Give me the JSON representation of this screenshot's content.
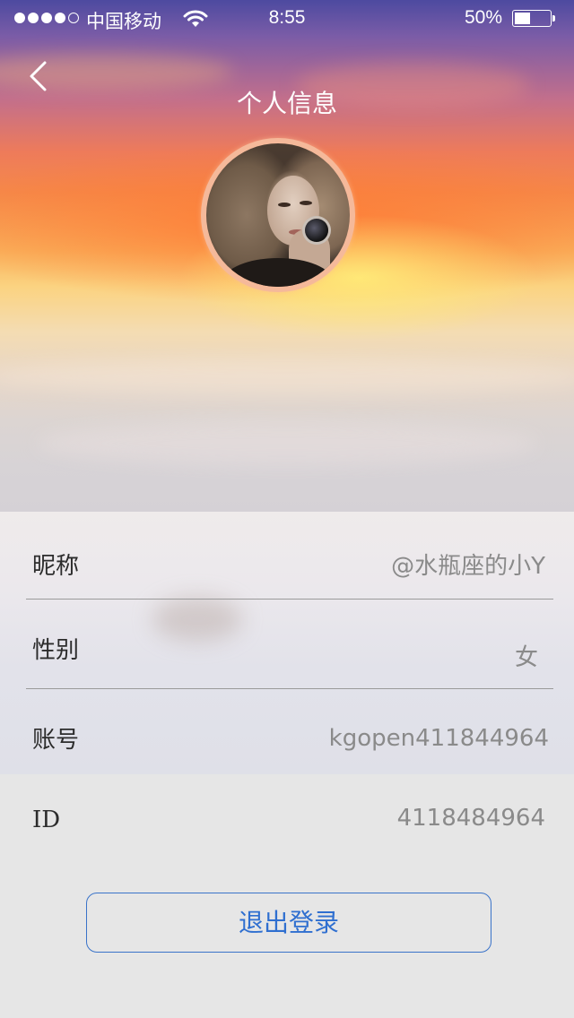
{
  "status_bar": {
    "carrier": "中国移动",
    "time": "8:55",
    "battery_percent": "50%",
    "battery_level": 0.5,
    "signal_bars_filled": 4,
    "signal_bars_total": 5
  },
  "nav": {
    "back_icon": "chevron-left-icon",
    "title": "个人信息"
  },
  "profile": {
    "rows": [
      {
        "label": "昵称",
        "value": "@水瓶座的小Y"
      },
      {
        "label": "性别",
        "value": "女"
      },
      {
        "label": "账号",
        "value": "kgopen411844964"
      },
      {
        "label": "ID",
        "value": "4118484964"
      }
    ]
  },
  "actions": {
    "logout_label": "退出登录"
  },
  "colors": {
    "accent": "#2f6fd0",
    "label_text": "#2c2c2c",
    "value_text": "#8a8a8a",
    "page_background": "#e6e6e6"
  }
}
